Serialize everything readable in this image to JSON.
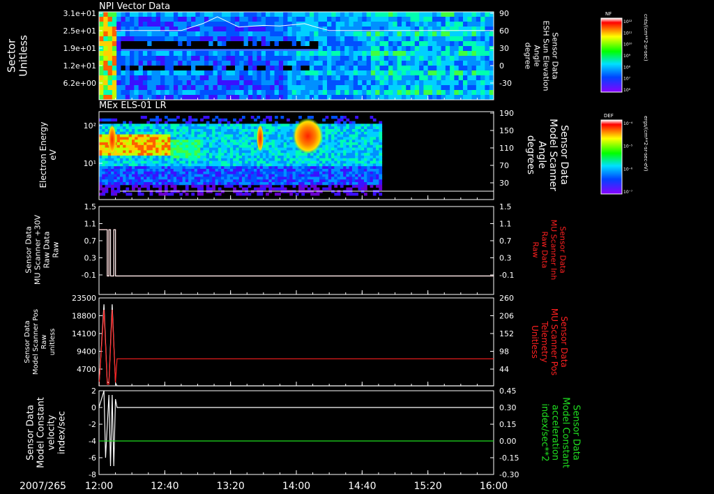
{
  "chart_data": [
    {
      "type": "heatmap",
      "title": "NPI Vector Data",
      "ylabel_left": [
        "Sector",
        "Unitless"
      ],
      "ylabel_right": [
        "Sensor Data",
        "ESH Sun Elevation",
        "Angle",
        "degree"
      ],
      "yticks_left": [
        "3.1e+01",
        "2.5e+01",
        "1.9e+01",
        "1.2e+01",
        "6.2e+00"
      ],
      "yticks_right": [
        "90",
        "60",
        "30",
        "0",
        "-30"
      ],
      "ylim_left": [
        0,
        31
      ],
      "ylim_right": [
        -60,
        90
      ],
      "colorbar": {
        "label": "NF",
        "unit": "cnts/(cm**2-sr-sec)",
        "ticks": [
          "10¹²",
          "10¹¹",
          "10¹⁰",
          "10⁹",
          "10⁸",
          "10⁷",
          "10⁶"
        ]
      },
      "overlay_line": {
        "series": "Sun Elevation Angle",
        "x": [
          "12:10",
          "12:50",
          "13:03",
          "13:12",
          "13:25",
          "13:40",
          "13:50",
          "14:05",
          "14:12",
          "14:20",
          "16:00"
        ],
        "y": [
          60,
          60,
          72,
          84,
          66,
          69,
          68,
          72,
          66,
          60,
          60
        ]
      }
    },
    {
      "type": "heatmap",
      "title": "MEx ELS-01 LR",
      "ylabel_left": [
        "Electron Energy",
        "eV"
      ],
      "ylabel_right": [
        "Sensor Data",
        "Model Scanner",
        "Angle",
        "degrees"
      ],
      "yticks_left": [
        "10²",
        "10¹"
      ],
      "yticks_right": [
        "190",
        "150",
        "110",
        "70",
        "30"
      ],
      "ylim_right": [
        10,
        190
      ],
      "data_end_time": "14:52",
      "colorbar": {
        "label": "DEF",
        "unit": "ergs/(cm**2-sr-sec-eV)",
        "ticks": [
          "10⁻⁴",
          "10⁻⁵",
          "10⁻⁶",
          "10⁻⁷"
        ]
      }
    },
    {
      "type": "line",
      "ylabel_left": [
        "Sensor Data",
        "MU Scanner +30V",
        "Raw Data",
        "Raw"
      ],
      "ylabel_right": [
        "Sensor Data",
        "MU Scanner Inh",
        "Raw Data",
        "Raw"
      ],
      "yticks_left": [
        "1.5",
        "1.1",
        "0.7",
        "0.3",
        "-0.1"
      ],
      "yticks_right": [
        "1.5",
        "1.1",
        "0.7",
        "0.3",
        "-0.1"
      ],
      "ylim": [
        -0.4,
        1.5
      ],
      "series": [
        {
          "axis": "right",
          "color": "#ff2020",
          "x": [
            "12:00",
            "12:05",
            "12:05",
            "12:06",
            "12:06",
            "12:07",
            "12:07",
            "12:09",
            "12:09",
            "12:10",
            "12:10",
            "16:00"
          ],
          "y": [
            1.0,
            1.0,
            0.0,
            0.0,
            1.0,
            1.0,
            0.0,
            0.0,
            1.0,
            1.0,
            0.0,
            0.0
          ]
        },
        {
          "axis": "left",
          "color": "#ffffff",
          "x": [
            "12:00",
            "12:05",
            "12:05",
            "12:06",
            "12:06",
            "12:07",
            "12:07",
            "12:09",
            "12:09",
            "12:10",
            "12:10",
            "16:00"
          ],
          "y": [
            1.0,
            1.0,
            0.0,
            0.0,
            1.0,
            1.0,
            0.0,
            0.0,
            1.0,
            1.0,
            0.0,
            0.0
          ]
        }
      ]
    },
    {
      "type": "line",
      "ylabel_left": [
        "Sensor Data",
        "Model Scanner Pos",
        "Raw",
        "unitless"
      ],
      "ylabel_right": [
        "Sensor Data",
        "MU Scanner Pos",
        "Telemetry",
        "Unitless"
      ],
      "yticks_left": [
        "23500",
        "18800",
        "14100",
        "9400",
        "4700"
      ],
      "yticks_right": [
        "260",
        "206",
        "152",
        "98",
        "44"
      ],
      "ylim_left": [
        0,
        23500
      ],
      "ylim_right": [
        0,
        260
      ],
      "series": [
        {
          "axis": "left",
          "color": "#ffffff",
          "x": [
            "12:00",
            "12:03",
            "12:05",
            "12:06",
            "12:08",
            "12:10",
            "12:11",
            "16:00"
          ],
          "y": [
            0,
            21800,
            1000,
            800,
            21800,
            800,
            0,
            0
          ]
        },
        {
          "axis": "right",
          "color": "#ff2020",
          "x": [
            "12:00",
            "12:03",
            "12:05",
            "12:06",
            "12:08",
            "12:10",
            "12:11",
            "16:00"
          ],
          "y": [
            0,
            225,
            5,
            5,
            225,
            10,
            80,
            80
          ]
        }
      ]
    },
    {
      "type": "line",
      "ylabel_left": [
        "Sensor Data",
        "Model Constant",
        "velocity",
        "index/sec"
      ],
      "ylabel_right": [
        "Sensor Data",
        "Model Constant",
        "acceleration",
        "index/sec**2"
      ],
      "yticks_left": [
        "2",
        "0",
        "-2",
        "-4",
        "-6",
        "-8"
      ],
      "yticks_right": [
        "0.45",
        "0.30",
        "0.15",
        "0.00",
        "-0.15",
        "-0.30"
      ],
      "ylim_left": [
        -8,
        2
      ],
      "ylim_right": [
        -0.3,
        0.45
      ],
      "series": [
        {
          "axis": "left",
          "color": "#ffffff",
          "x": [
            "12:00",
            "12:03",
            "12:04",
            "12:06",
            "12:07",
            "12:08",
            "12:09",
            "12:10",
            "12:11",
            "16:00"
          ],
          "y": [
            0,
            2,
            -6,
            1.5,
            -7,
            1.5,
            -7,
            1,
            0,
            0
          ]
        },
        {
          "axis": "right",
          "color": "#20e020",
          "x": [
            "12:00",
            "16:00"
          ],
          "y": [
            0,
            0
          ]
        }
      ]
    }
  ],
  "time_axis": {
    "date_label": "2007/265",
    "ticks": [
      "12:00",
      "12:40",
      "13:20",
      "14:00",
      "14:40",
      "15:20",
      "16:00"
    ],
    "range": [
      "12:00",
      "16:00"
    ]
  }
}
